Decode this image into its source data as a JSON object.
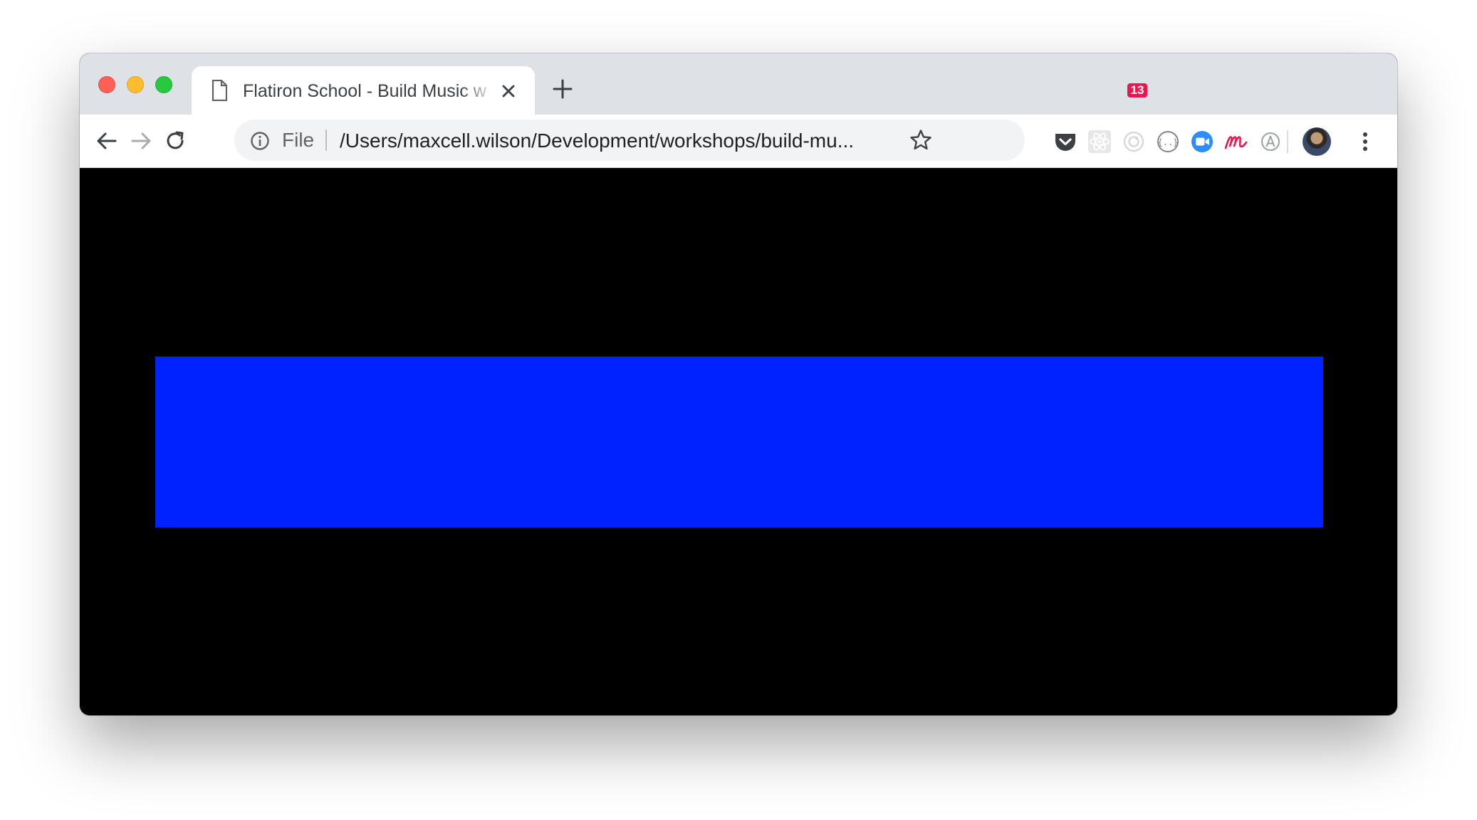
{
  "window": {
    "controls": [
      "close",
      "minimize",
      "maximize"
    ]
  },
  "tab": {
    "title": "Flatiron School - Build Music w",
    "icon": "document-icon"
  },
  "toolbar": {
    "scheme_label": "File",
    "url": "/Users/maxcell.wilson/Development/workshops/build-mu..."
  },
  "extensions": {
    "badge_count": "13",
    "items": [
      "pocket-icon",
      "react-devtools-icon",
      "chromecast-like-icon",
      "json-viewer-icon",
      "zoom-icon",
      "mixmax-icon",
      "accessibility-icon"
    ]
  },
  "colors": {
    "content_background": "#000000",
    "rectangle": "#0022ff",
    "traffic_red": "#fe5f57",
    "traffic_yellow": "#febc2e",
    "traffic_green": "#28c840"
  }
}
